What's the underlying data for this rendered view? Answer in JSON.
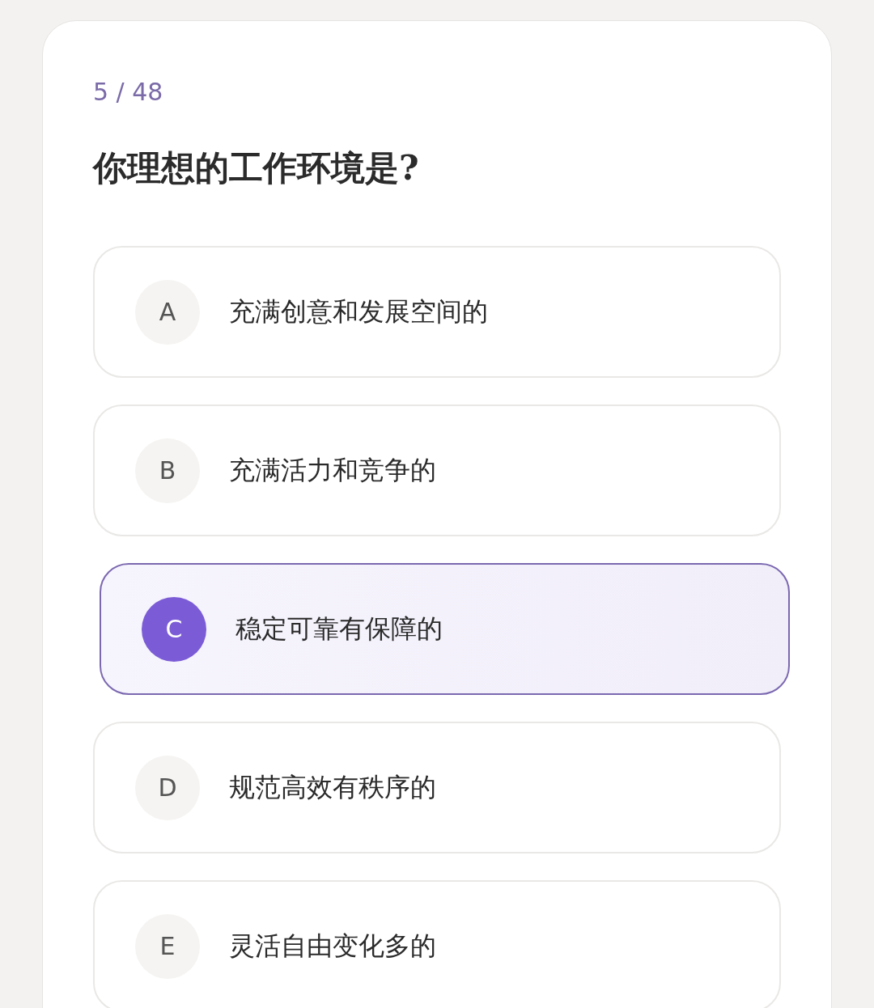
{
  "progress": "5 / 48",
  "question": "你理想的工作环境是?",
  "options": [
    {
      "letter": "A",
      "text": "充满创意和发展空间的",
      "selected": false
    },
    {
      "letter": "B",
      "text": "充满活力和竞争的",
      "selected": false
    },
    {
      "letter": "C",
      "text": "稳定可靠有保障的",
      "selected": true
    },
    {
      "letter": "D",
      "text": "规范高效有秩序的",
      "selected": false
    },
    {
      "letter": "E",
      "text": "灵活自由变化多的",
      "selected": false
    }
  ]
}
